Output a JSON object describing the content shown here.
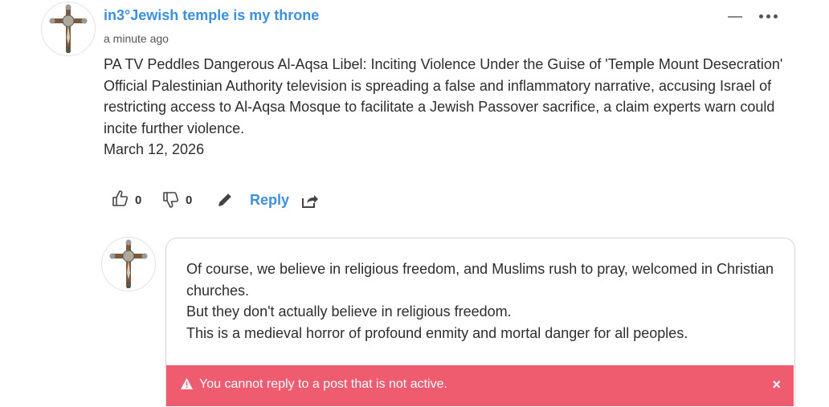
{
  "post": {
    "username": "in3°Jewish temple is my throne",
    "timestamp": "a minute ago",
    "lines": [
      "PA TV Peddles Dangerous Al-Aqsa Libel: Inciting Violence Under the Guise of 'Temple Mount Desecration'",
      "Official Palestinian Authority television is spreading a false and inflammatory narrative, accusing Israel of restricting access to Al-Aqsa Mosque to facilitate a Jewish Passover sacrifice, a claim experts warn could incite further violence.",
      "March 12, 2026"
    ],
    "likes": "0",
    "dislikes": "0",
    "reply_label": "Reply"
  },
  "reply": {
    "lines": [
      "Of course, we believe in religious freedom, and Muslims rush to pray, welcomed in Christian churches.",
      "But they don't actually believe in religious freedom.",
      "This is a medieval horror of profound enmity and mortal danger for all peoples."
    ]
  },
  "alert": {
    "message": "You cannot reply to a post that is not active.",
    "close": "×"
  },
  "colors": {
    "accent": "#3d8fe0",
    "alert_bg": "#ef5b6f"
  },
  "icons": [
    "crucifix-avatar-icon",
    "minimize-icon",
    "more-options-icon",
    "thumbs-up-icon",
    "thumbs-down-icon",
    "edit-pencil-icon",
    "share-icon",
    "warning-icon",
    "close-icon"
  ]
}
